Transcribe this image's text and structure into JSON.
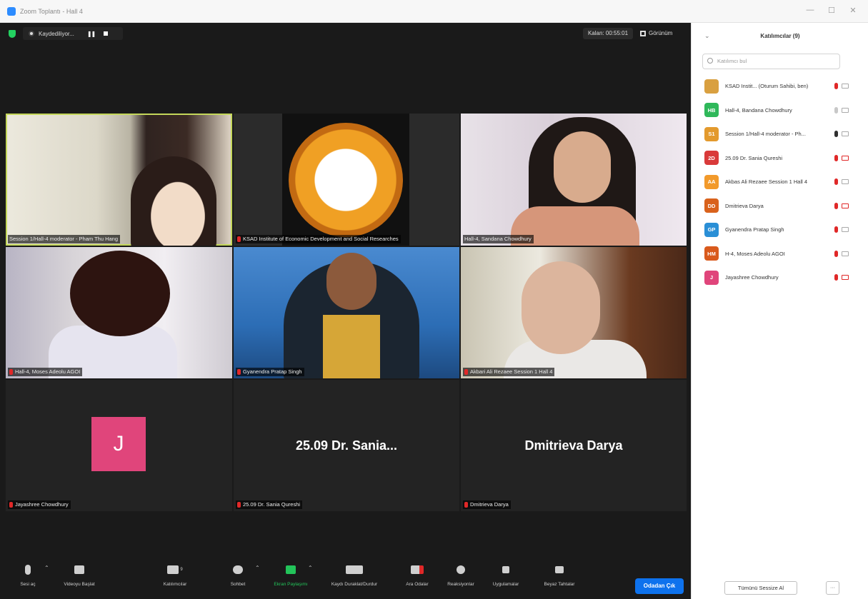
{
  "window": {
    "title": "Zoom Toplantı - Hall 4",
    "minimize": "—",
    "maximize": "☐",
    "close": "✕"
  },
  "recording": {
    "label": "Kaydediliyor...",
    "pause_icon": "❚❚"
  },
  "top_right": {
    "exit_fullscreen": "Kalan: 00:55:01",
    "view": "Görünüm"
  },
  "tiles": [
    {
      "name": "Session 1/Hall-4 moderator - Pham Thu Hang",
      "muted": false
    },
    {
      "name": "KSAD Institute of Economic Development and Social Researches",
      "muted": true
    },
    {
      "name": "Hall-4, Sandana Chowdhury",
      "muted": false
    },
    {
      "name": "Hall-4, Moses Adeolu AGOI",
      "muted": true
    },
    {
      "name": "Gyanendra Pratap Singh",
      "muted": true
    },
    {
      "name": "Akbari Ali Rezaee Session 1 Hall 4",
      "muted": true
    },
    {
      "name": "Jayashree Chowdhury",
      "muted": true,
      "avatar_letter": "J",
      "avatar_color": "#e0457b"
    },
    {
      "name": "25.09 Dr. Sania Qureshi",
      "muted": true,
      "big_label": "25.09  Dr. Sania..."
    },
    {
      "name": "Dmitrieva Darya",
      "muted": true,
      "big_label": "Dmitrieva Darya"
    }
  ],
  "toolbar": {
    "items": [
      {
        "label": "Sesi aç",
        "icon": "mic-muted-icon"
      },
      {
        "label": "Videoyu Başlat",
        "icon": "video-off-icon"
      },
      {
        "label": "Katılımcılar",
        "icon": "participants-icon",
        "count": "9"
      },
      {
        "label": "Sohbet",
        "icon": "chat-icon"
      },
      {
        "label": "Ekran Paylaşımı",
        "icon": "share-screen-icon"
      },
      {
        "label": "Kaydı Duraklat/Durdur",
        "icon": "record-icon"
      },
      {
        "label": "Ara Odalar",
        "icon": "breakout-icon"
      },
      {
        "label": "Reaksiyonlar",
        "icon": "reactions-icon"
      },
      {
        "label": "Uygulamalar",
        "icon": "apps-icon"
      },
      {
        "label": "Beyaz Tahtalar",
        "icon": "whiteboard-icon"
      }
    ],
    "leave": "Odadan Çık"
  },
  "sidebar": {
    "title": "Katılımcılar (9)",
    "search_placeholder": "Katılımcı bul",
    "participants": [
      {
        "initials": "",
        "color": "#d9a040",
        "name": "KSAD Instit... (Oturum Sahibi, ben)",
        "mic": "muted",
        "cam": "on"
      },
      {
        "initials": "HB",
        "color": "#2fb85a",
        "name": "Hall-4, Bandana Chowdhury",
        "mic": "off",
        "cam": "off"
      },
      {
        "initials": "S1",
        "color": "#e39a2d",
        "name": "Session 1/Hall-4 moderator - Ph...",
        "mic": "live",
        "cam": "off"
      },
      {
        "initials": "2D",
        "color": "#d93a3a",
        "name": "25.09 Dr. Sania Qureshi",
        "mic": "muted",
        "cam": "muted"
      },
      {
        "initials": "AA",
        "color": "#f29a2b",
        "name": "Akbas Ali Rezaee Session 1 Hall 4",
        "mic": "muted",
        "cam": "off"
      },
      {
        "initials": "DD",
        "color": "#d9621c",
        "name": "Dmitrieva Darya",
        "mic": "muted",
        "cam": "muted"
      },
      {
        "initials": "GP",
        "color": "#2a8fd6",
        "name": "Gyanendra Pratap Singh",
        "mic": "muted",
        "cam": "off"
      },
      {
        "initials": "HM",
        "color": "#d95a1c",
        "name": "H-4, Moses Adeolu AGOI",
        "mic": "muted",
        "cam": "off"
      },
      {
        "initials": "J",
        "color": "#e0457b",
        "name": "Jayashree Chowdhury",
        "mic": "muted",
        "cam": "muted"
      }
    ],
    "mute_all": "Tümünü Sessize Al",
    "more": "···"
  }
}
